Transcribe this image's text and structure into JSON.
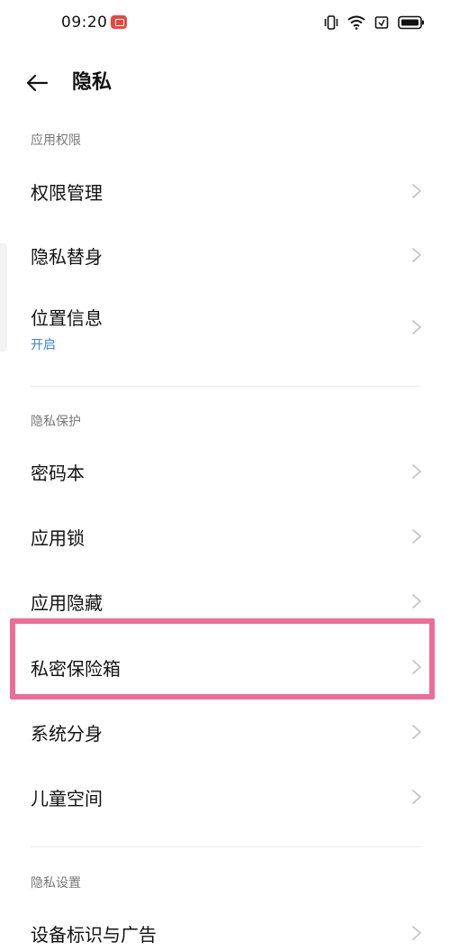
{
  "status_bar": {
    "time": "09:20"
  },
  "header": {
    "title": "隐私"
  },
  "sections": [
    {
      "label": "应用权限",
      "items": [
        {
          "label": "权限管理"
        },
        {
          "label": "隐私替身"
        },
        {
          "label": "位置信息",
          "subtitle": "开启"
        }
      ]
    },
    {
      "label": "隐私保护",
      "items": [
        {
          "label": "密码本"
        },
        {
          "label": "应用锁"
        },
        {
          "label": "应用隐藏"
        },
        {
          "label": "私密保险箱"
        },
        {
          "label": "系统分身"
        },
        {
          "label": "儿童空间"
        }
      ]
    },
    {
      "label": "隐私设置",
      "items": [
        {
          "label": "设备标识与广告"
        }
      ]
    }
  ],
  "colors": {
    "accent": "#3a86e6",
    "highlight_border": "#ec6d97",
    "record_badge": "#e8473f"
  }
}
